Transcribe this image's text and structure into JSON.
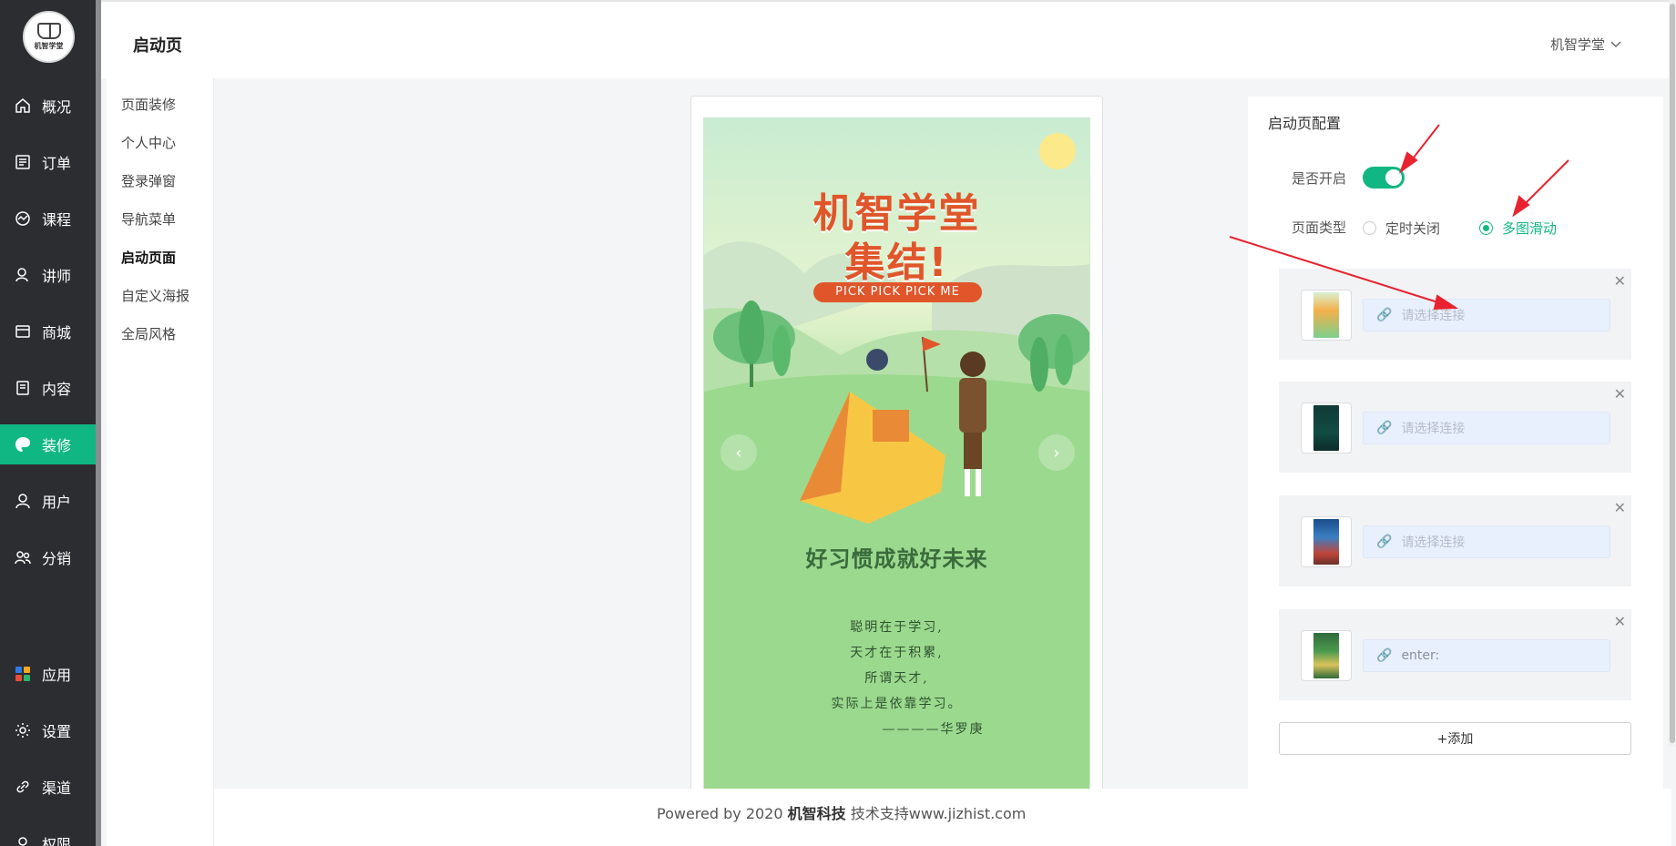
{
  "brand": {
    "logo_text": "机智学堂",
    "accent": "#11b782",
    "sidebar_bg": "#2b2d30"
  },
  "sidebar": {
    "items": [
      {
        "label": "概况",
        "icon": "home-icon"
      },
      {
        "label": "订单",
        "icon": "order-icon"
      },
      {
        "label": "课程",
        "icon": "course-icon"
      },
      {
        "label": "讲师",
        "icon": "teacher-icon"
      },
      {
        "label": "商城",
        "icon": "store-icon"
      },
      {
        "label": "内容",
        "icon": "content-icon"
      },
      {
        "label": "装修",
        "icon": "decorate-icon",
        "active": true
      },
      {
        "label": "用户",
        "icon": "user-icon"
      },
      {
        "label": "分销",
        "icon": "distribution-icon"
      },
      {
        "label": "应用",
        "icon": "apps-icon"
      },
      {
        "label": "设置",
        "icon": "gear-icon"
      },
      {
        "label": "渠道",
        "icon": "link-icon"
      },
      {
        "label": "权限",
        "icon": "permission-icon"
      }
    ]
  },
  "header": {
    "title": "启动页",
    "user": "机智学堂"
  },
  "submenu": {
    "items": [
      {
        "label": "页面装修"
      },
      {
        "label": "个人中心"
      },
      {
        "label": "登录弹窗"
      },
      {
        "label": "导航菜单"
      },
      {
        "label": "启动页面",
        "active": true
      },
      {
        "label": "自定义海报"
      },
      {
        "label": "全局风格"
      }
    ]
  },
  "preview": {
    "title_line1": "机智学堂",
    "title_line2": "集结!",
    "banner": "PICK PICK PICK ME",
    "slogan": "好习惯成就好未来",
    "poem": [
      "聪明在于学习,",
      "天才在于积累,",
      "所谓天才,",
      "实际上是依靠学习。",
      "————华罗庚"
    ]
  },
  "config": {
    "title": "启动页配置",
    "enable_label": "是否开启",
    "enabled": true,
    "type_label": "页面类型",
    "type_options": [
      "定时关闭",
      "多图滑动"
    ],
    "type_selected": "多图滑动",
    "slides": [
      {
        "placeholder": "请选择连接",
        "value": ""
      },
      {
        "placeholder": "请选择连接",
        "value": ""
      },
      {
        "placeholder": "请选择连接",
        "value": ""
      },
      {
        "placeholder": "请选择连接",
        "value": "enter:"
      }
    ],
    "add_label": "+添加"
  },
  "footer": {
    "prefix": "Powered by 2020 ",
    "company": "机智科技",
    "suffix": " 技术支持www.jizhist.com"
  }
}
